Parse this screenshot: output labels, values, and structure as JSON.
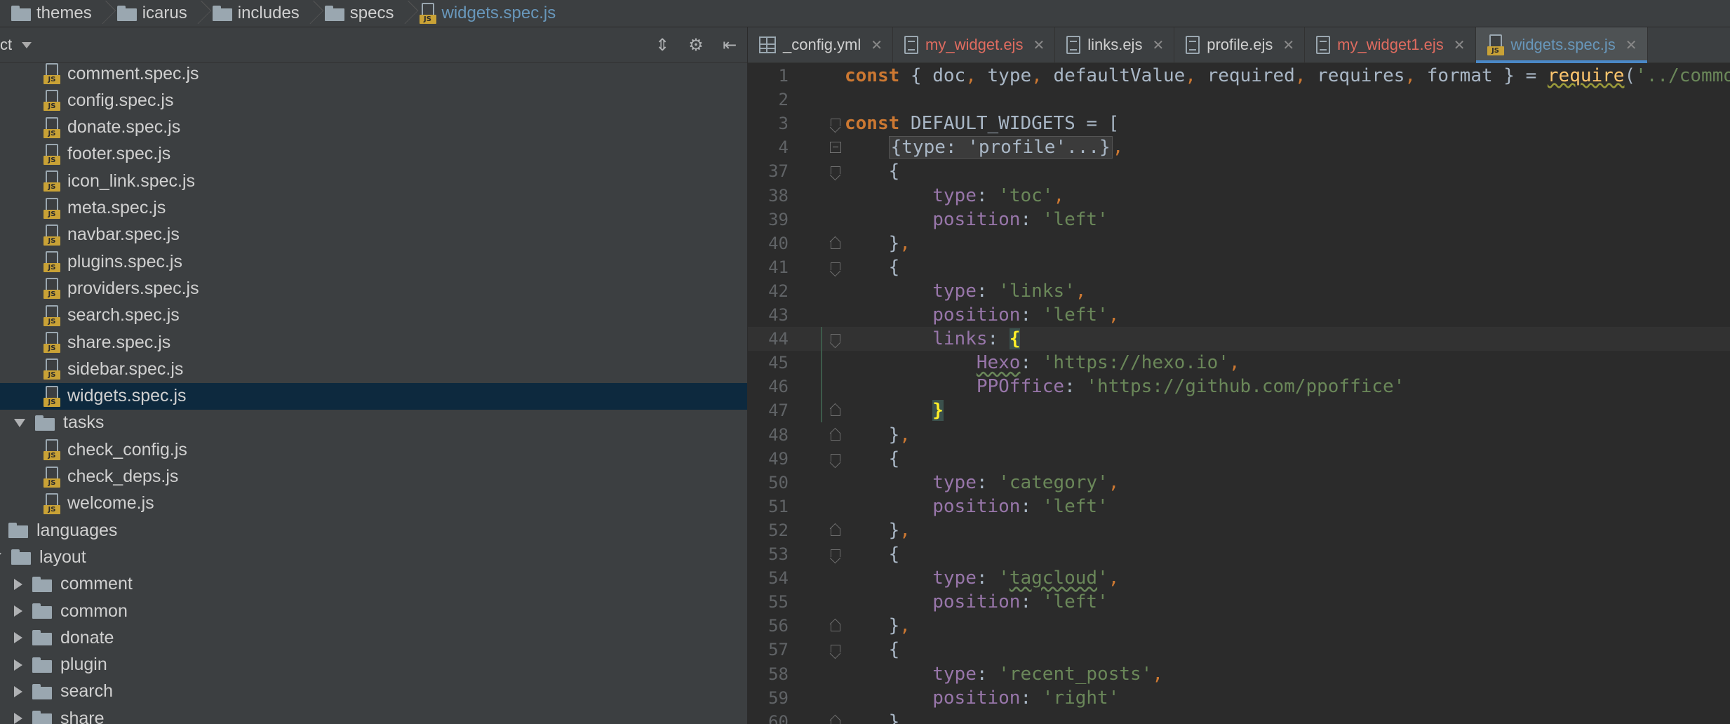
{
  "breadcrumb": [
    {
      "label": "themes",
      "icon": "folder-icon"
    },
    {
      "label": "icarus",
      "icon": "folder-icon"
    },
    {
      "label": "includes",
      "icon": "folder-icon"
    },
    {
      "label": "specs",
      "icon": "folder-icon"
    },
    {
      "label": "widgets.spec.js",
      "icon": "js-file-icon"
    }
  ],
  "project": {
    "title": "ct",
    "tree": [
      {
        "label": "comment.spec.js",
        "type": "js",
        "indent": 2
      },
      {
        "label": "config.spec.js",
        "type": "js",
        "indent": 2
      },
      {
        "label": "donate.spec.js",
        "type": "js",
        "indent": 2
      },
      {
        "label": "footer.spec.js",
        "type": "js",
        "indent": 2
      },
      {
        "label": "icon_link.spec.js",
        "type": "js",
        "indent": 2
      },
      {
        "label": "meta.spec.js",
        "type": "js",
        "indent": 2
      },
      {
        "label": "navbar.spec.js",
        "type": "js",
        "indent": 2
      },
      {
        "label": "plugins.spec.js",
        "type": "js",
        "indent": 2
      },
      {
        "label": "providers.spec.js",
        "type": "js",
        "indent": 2
      },
      {
        "label": "search.spec.js",
        "type": "js",
        "indent": 2
      },
      {
        "label": "share.spec.js",
        "type": "js",
        "indent": 2
      },
      {
        "label": "sidebar.spec.js",
        "type": "js",
        "indent": 2
      },
      {
        "label": "widgets.spec.js",
        "type": "js",
        "indent": 2,
        "selected": true
      },
      {
        "label": "tasks",
        "type": "folder",
        "indent": 1,
        "expanded": true
      },
      {
        "label": "check_config.js",
        "type": "js",
        "indent": 2
      },
      {
        "label": "check_deps.js",
        "type": "js",
        "indent": 2
      },
      {
        "label": "welcome.js",
        "type": "js",
        "indent": 2
      },
      {
        "label": "languages",
        "type": "folder",
        "indent": 0,
        "expanded": false
      },
      {
        "label": "layout",
        "type": "folder",
        "indent": 0,
        "expanded": true
      },
      {
        "label": "comment",
        "type": "folder",
        "indent": 1,
        "expanded": false
      },
      {
        "label": "common",
        "type": "folder",
        "indent": 1,
        "expanded": false
      },
      {
        "label": "donate",
        "type": "folder",
        "indent": 1,
        "expanded": false
      },
      {
        "label": "plugin",
        "type": "folder",
        "indent": 1,
        "expanded": false
      },
      {
        "label": "search",
        "type": "folder",
        "indent": 1,
        "expanded": false
      },
      {
        "label": "share",
        "type": "folder",
        "indent": 1,
        "expanded": false
      }
    ]
  },
  "tabs": [
    {
      "label": "_config.yml",
      "icon": "grid-file-icon",
      "modified": false,
      "active": false
    },
    {
      "label": "my_widget.ejs",
      "icon": "doc-file-icon",
      "modified": true,
      "active": false
    },
    {
      "label": "links.ejs",
      "icon": "doc-file-icon",
      "modified": false,
      "active": false
    },
    {
      "label": "profile.ejs",
      "icon": "doc-file-icon",
      "modified": false,
      "active": false
    },
    {
      "label": "my_widget1.ejs",
      "icon": "doc-file-icon",
      "modified": true,
      "active": false
    },
    {
      "label": "widgets.spec.js",
      "icon": "js-file-icon",
      "modified": false,
      "active": true
    }
  ],
  "code": [
    {
      "n": "1",
      "fold": "",
      "tokens": [
        [
          "kw",
          "const "
        ],
        [
          "plain",
          "{ doc"
        ],
        [
          "pun",
          ", "
        ],
        [
          "plain",
          "type"
        ],
        [
          "pun",
          ", "
        ],
        [
          "plain",
          "defaultValue"
        ],
        [
          "pun",
          ", "
        ],
        [
          "plain",
          "required"
        ],
        [
          "pun",
          ", "
        ],
        [
          "plain",
          "requires"
        ],
        [
          "pun",
          ", "
        ],
        [
          "plain",
          "format } = "
        ],
        [
          "fn",
          "require"
        ],
        [
          "plain",
          "("
        ],
        [
          "str",
          "'../common"
        ]
      ]
    },
    {
      "n": "2",
      "fold": "",
      "tokens": []
    },
    {
      "n": "3",
      "fold": "open",
      "tokens": [
        [
          "kw",
          "const "
        ],
        [
          "plain",
          "DEFAULT_WIDGETS = ["
        ]
      ]
    },
    {
      "n": "4",
      "fold": "closed",
      "tokens": [
        [
          "plain",
          "    "
        ],
        [
          "folded",
          "{type: 'profile'...}"
        ],
        [
          "pun",
          ","
        ]
      ]
    },
    {
      "n": "37",
      "fold": "open",
      "tokens": [
        [
          "plain",
          "    {"
        ]
      ]
    },
    {
      "n": "38",
      "fold": "",
      "tokens": [
        [
          "plain",
          "        "
        ],
        [
          "prop",
          "type"
        ],
        [
          "plain",
          ": "
        ],
        [
          "str",
          "'toc'"
        ],
        [
          "pun",
          ","
        ]
      ]
    },
    {
      "n": "39",
      "fold": "",
      "tokens": [
        [
          "plain",
          "        "
        ],
        [
          "prop",
          "position"
        ],
        [
          "plain",
          ": "
        ],
        [
          "str",
          "'left'"
        ]
      ]
    },
    {
      "n": "40",
      "fold": "end",
      "tokens": [
        [
          "plain",
          "    }"
        ],
        [
          "pun",
          ","
        ]
      ]
    },
    {
      "n": "41",
      "fold": "open",
      "tokens": [
        [
          "plain",
          "    {"
        ]
      ]
    },
    {
      "n": "42",
      "fold": "",
      "tokens": [
        [
          "plain",
          "        "
        ],
        [
          "prop",
          "type"
        ],
        [
          "plain",
          ": "
        ],
        [
          "str",
          "'links'"
        ],
        [
          "pun",
          ","
        ]
      ]
    },
    {
      "n": "43",
      "fold": "",
      "tokens": [
        [
          "plain",
          "        "
        ],
        [
          "prop",
          "position"
        ],
        [
          "plain",
          ": "
        ],
        [
          "str",
          "'left'"
        ],
        [
          "pun",
          ","
        ]
      ]
    },
    {
      "n": "44",
      "fold": "open",
      "caret": true,
      "tokens": [
        [
          "plain",
          "        "
        ],
        [
          "prop",
          "links"
        ],
        [
          "plain",
          ": "
        ],
        [
          "brace",
          "{"
        ]
      ]
    },
    {
      "n": "45",
      "fold": "",
      "tokens": [
        [
          "plain",
          "            "
        ],
        [
          "propTypo",
          "Hexo"
        ],
        [
          "plain",
          ": "
        ],
        [
          "str",
          "'https://hexo.io'"
        ],
        [
          "pun",
          ","
        ]
      ]
    },
    {
      "n": "46",
      "fold": "",
      "tokens": [
        [
          "plain",
          "            "
        ],
        [
          "prop",
          "PPOffice"
        ],
        [
          "plain",
          ": "
        ],
        [
          "str",
          "'https://github.com/ppoffice'"
        ]
      ]
    },
    {
      "n": "47",
      "fold": "end",
      "tokens": [
        [
          "plain",
          "        "
        ],
        [
          "brace",
          "}"
        ]
      ]
    },
    {
      "n": "48",
      "fold": "end",
      "tokens": [
        [
          "plain",
          "    }"
        ],
        [
          "pun",
          ","
        ]
      ]
    },
    {
      "n": "49",
      "fold": "open",
      "tokens": [
        [
          "plain",
          "    {"
        ]
      ]
    },
    {
      "n": "50",
      "fold": "",
      "tokens": [
        [
          "plain",
          "        "
        ],
        [
          "prop",
          "type"
        ],
        [
          "plain",
          ": "
        ],
        [
          "str",
          "'category'"
        ],
        [
          "pun",
          ","
        ]
      ]
    },
    {
      "n": "51",
      "fold": "",
      "tokens": [
        [
          "plain",
          "        "
        ],
        [
          "prop",
          "position"
        ],
        [
          "plain",
          ": "
        ],
        [
          "str",
          "'left'"
        ]
      ]
    },
    {
      "n": "52",
      "fold": "end",
      "tokens": [
        [
          "plain",
          "    }"
        ],
        [
          "pun",
          ","
        ]
      ]
    },
    {
      "n": "53",
      "fold": "open",
      "tokens": [
        [
          "plain",
          "    {"
        ]
      ]
    },
    {
      "n": "54",
      "fold": "",
      "tokens": [
        [
          "plain",
          "        "
        ],
        [
          "prop",
          "type"
        ],
        [
          "plain",
          ": "
        ],
        [
          "str",
          "'"
        ],
        [
          "strTypo",
          "tagcloud"
        ],
        [
          "str",
          "'"
        ],
        [
          "pun",
          ","
        ]
      ]
    },
    {
      "n": "55",
      "fold": "",
      "tokens": [
        [
          "plain",
          "        "
        ],
        [
          "prop",
          "position"
        ],
        [
          "plain",
          ": "
        ],
        [
          "str",
          "'left'"
        ]
      ]
    },
    {
      "n": "56",
      "fold": "end",
      "tokens": [
        [
          "plain",
          "    }"
        ],
        [
          "pun",
          ","
        ]
      ]
    },
    {
      "n": "57",
      "fold": "open",
      "tokens": [
        [
          "plain",
          "    {"
        ]
      ]
    },
    {
      "n": "58",
      "fold": "",
      "tokens": [
        [
          "plain",
          "        "
        ],
        [
          "prop",
          "type"
        ],
        [
          "plain",
          ": "
        ],
        [
          "str",
          "'recent_posts'"
        ],
        [
          "pun",
          ","
        ]
      ]
    },
    {
      "n": "59",
      "fold": "",
      "tokens": [
        [
          "plain",
          "        "
        ],
        [
          "prop",
          "position"
        ],
        [
          "plain",
          ": "
        ],
        [
          "str",
          "'right'"
        ]
      ]
    },
    {
      "n": "60",
      "fold": "end",
      "tokens": [
        [
          "plain",
          "    }"
        ],
        [
          "pun",
          ","
        ]
      ]
    }
  ]
}
